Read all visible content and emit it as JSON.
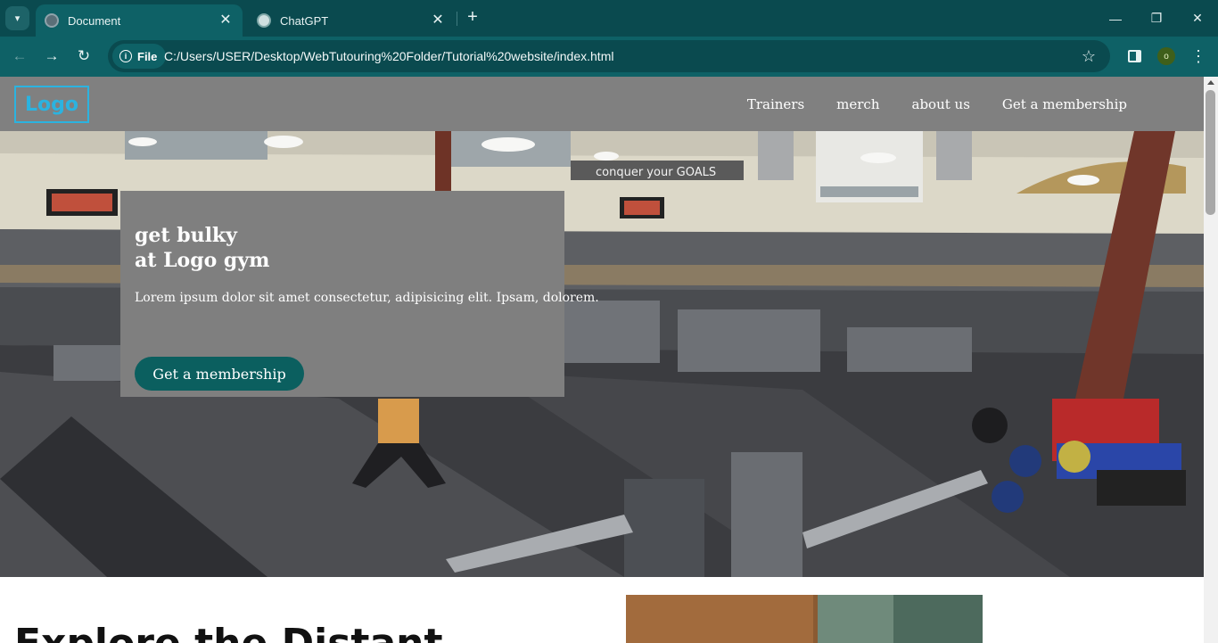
{
  "browser": {
    "tabs": [
      {
        "title": "Document",
        "active": true
      },
      {
        "title": "ChatGPT",
        "active": false
      }
    ],
    "address_bar": {
      "chip_label": "File",
      "url": "C:/Users/USER/Desktop/WebTutouring%20Folder/Tutorial%20website/index.html"
    },
    "profile_initial": "o",
    "icons": {
      "tab_search": "chevron-down-icon",
      "tab_close": "close-icon",
      "new_tab": "plus-icon",
      "back": "arrow-left-icon",
      "forward": "arrow-right-icon",
      "reload": "reload-icon",
      "site_info": "info-icon",
      "bookmark": "star-icon",
      "side_panel": "side-panel-icon",
      "menu": "kebab-menu-icon",
      "minimize": "minimize-icon",
      "restore": "restore-icon",
      "close": "close-icon"
    },
    "colors": {
      "frame": "#0a4a4f",
      "toolbar": "#0e6166"
    }
  },
  "site": {
    "logo": "Logo",
    "nav_links": [
      "Trainers",
      "merch",
      "about us",
      "Get a membership"
    ],
    "hero": {
      "title_line1": "get bulky",
      "title_line2": "at Logo gym",
      "text": "Lorem ipsum dolor sit amet consectetur, adipisicing elit. Ipsam, dolorem.",
      "cta": "Get a membership",
      "image_sign": "conquer your GOALS"
    },
    "section_heading": "Explore the Distant",
    "colors": {
      "nav_bg": "#808080",
      "logo": "#2bb3e0",
      "cta": "#0b5f5f"
    }
  }
}
